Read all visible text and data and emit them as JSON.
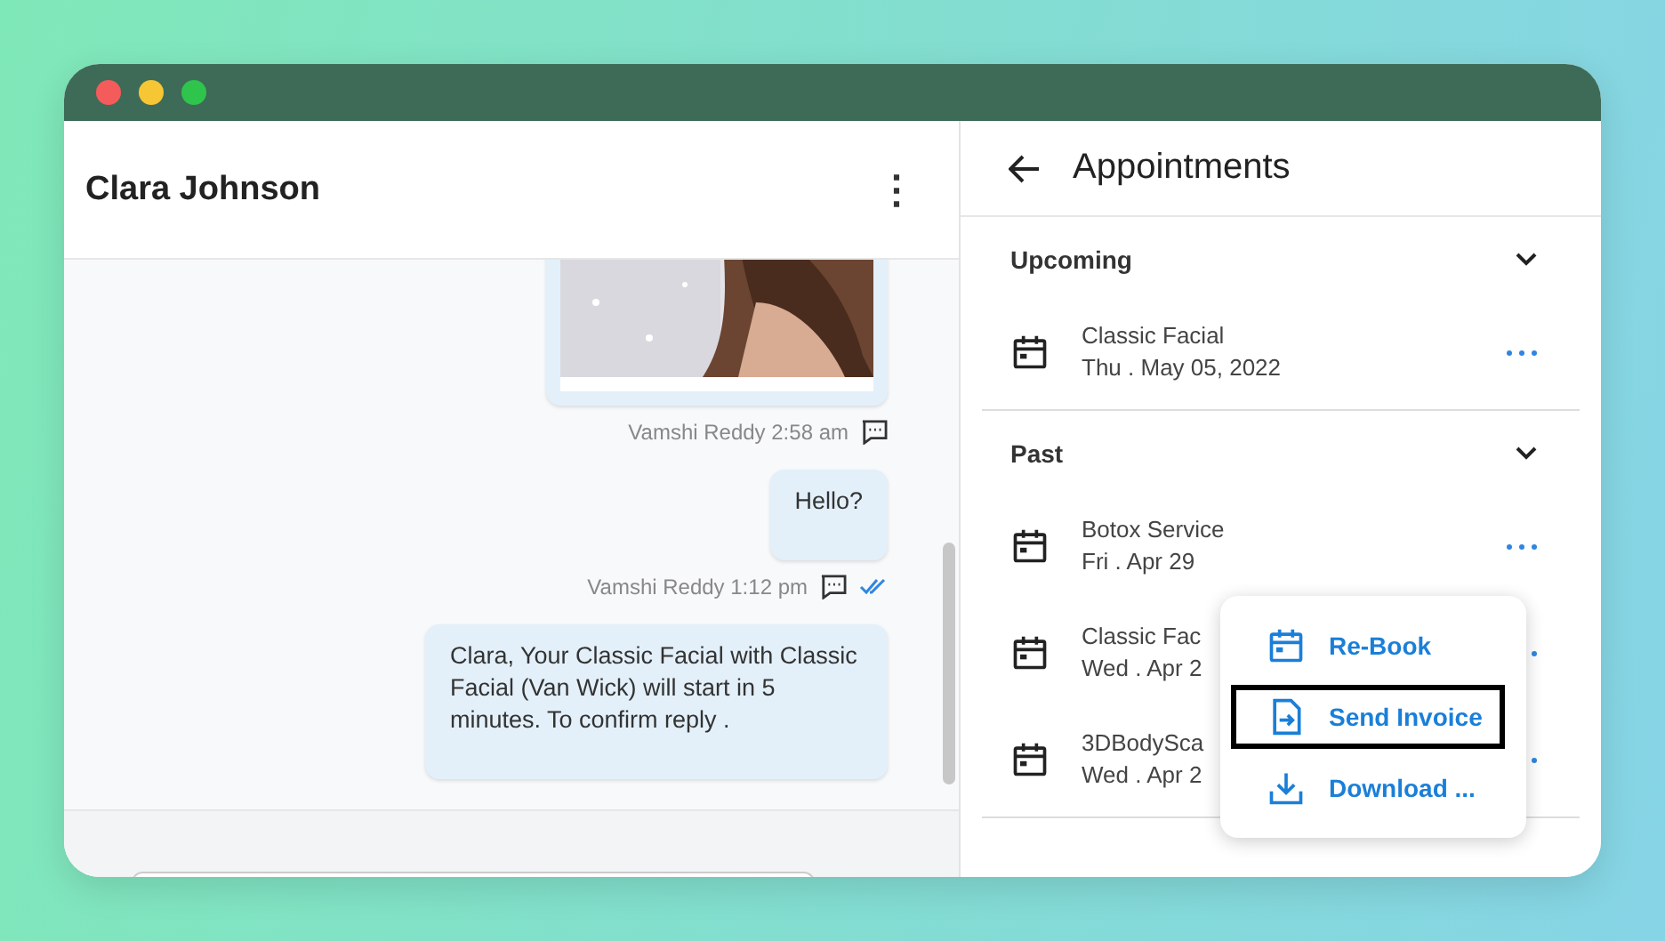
{
  "contact": {
    "name": "Clara Johnson",
    "more_icon": "⋮"
  },
  "messages": [
    {
      "meta": "Vamshi Reddy 2:58 am",
      "read": false
    },
    {
      "kind": "text",
      "text": "Hello?",
      "meta": "Vamshi Reddy 1:12 pm",
      "read": true
    },
    {
      "kind": "text",
      "text": "Clara, Your Classic Facial with Classic Facial (Van Wick) will start in 5 minutes. To confirm reply ."
    }
  ],
  "appointments": {
    "title": "Appointments",
    "sections": [
      {
        "title": "Upcoming",
        "expanded": true,
        "items": [
          {
            "name": "Classic Facial",
            "date": "Thu . May 05, 2022"
          }
        ]
      },
      {
        "title": "Past",
        "expanded": true,
        "items": [
          {
            "name": "Botox Service",
            "date": "Fri . Apr 29"
          },
          {
            "name": "Classic Fac",
            "date": "Wed . Apr 2"
          },
          {
            "name": "3DBodySca",
            "date": "Wed . Apr 2"
          }
        ]
      }
    ]
  },
  "menu": [
    {
      "label": "Re-Book",
      "highlighted": false
    },
    {
      "label": "Send Invoice",
      "highlighted": true
    },
    {
      "label": "Download ...",
      "highlighted": false
    }
  ]
}
